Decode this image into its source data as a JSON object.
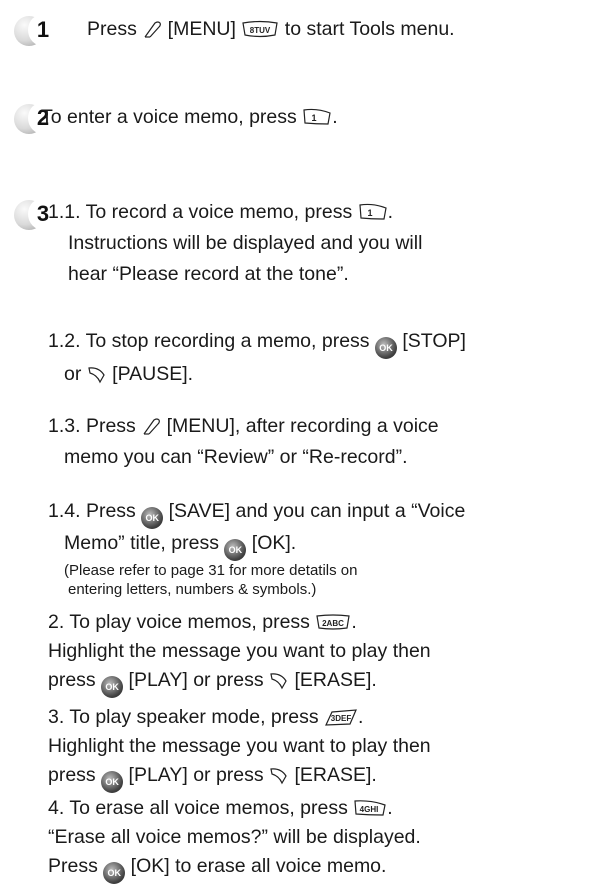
{
  "step1": {
    "number": "1",
    "text_a": "Press ",
    "text_b": " [MENU] ",
    "text_c": " to start Tools menu.",
    "menu_key_label": "8TUV"
  },
  "step2": {
    "number": "2",
    "text_a": "To enter a voice memo, press ",
    "text_b": ".",
    "key_label": "1"
  },
  "step3": {
    "number": "3",
    "i11": {
      "l1a": "1.1. To record a voice memo, press ",
      "l1b": ".",
      "l2": "Instructions will be displayed and you will",
      "l3": "hear “Please record at the tone”."
    },
    "i12": {
      "l1a": "1.2. To stop recording a memo, press ",
      "l1b": " [STOP]",
      "l2a": "or ",
      "l2b": " [PAUSE]."
    },
    "i13": {
      "l1a": "1.3. Press ",
      "l1b": " [MENU], after recording a voice",
      "l2": "memo you can “Review” or “Re-record”."
    },
    "i14": {
      "l1a": "1.4. Press ",
      "l1b": " [SAVE] and you can input a “Voice",
      "l2a": "Memo” title, press ",
      "l2b": " [OK].",
      "n1": "(Please refer to page 31 for more detatils on",
      "n2": "entering letters, numbers & symbols.)"
    },
    "i2": {
      "l1a": "2. To play voice memos, press ",
      "l1b": ".",
      "l2": "Highlight the message you want to play then",
      "l3a": "press ",
      "l3b": " [PLAY] or press ",
      "l3c": " [ERASE].",
      "key_label": "2ABC"
    },
    "i3": {
      "l1a": "3. To play speaker mode, press ",
      "l1b": ".",
      "l2": "Highlight the message you want to play then",
      "l3a": "press ",
      "l3b": " [PLAY] or press ",
      "l3c": " [ERASE].",
      "key_label": "3DEF"
    },
    "i4": {
      "l1a": "4. To erase all voice memos, press ",
      "l1b": ".",
      "l2": "“Erase all voice memos?” will be displayed.",
      "l3a": "Press ",
      "l3b": " [OK] to erase all voice memo.",
      "key_label": "4GHI"
    },
    "ok_label": "OK"
  }
}
